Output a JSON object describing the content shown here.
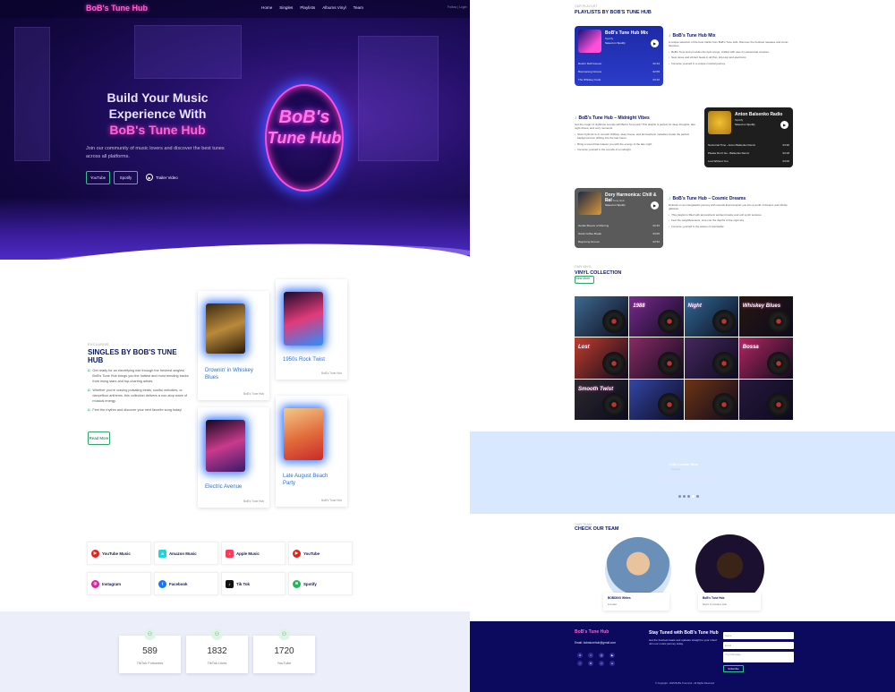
{
  "brand": "BoB's Tune Hub",
  "nav": [
    "Home",
    "Singles",
    "Playlists",
    "Albums Vinyl",
    "Team"
  ],
  "topbar_right": "Follow | Login",
  "hero": {
    "title_line1": "Build Your Music",
    "title_line2": "Experience With",
    "title_line3": "BoB's Tune Hub",
    "subtitle": "Join our community of music lovers and discover the best tunes across all platforms.",
    "btn_youtube": "YouTube",
    "btn_spotify": "Spotify",
    "trailer": "Trailer Video",
    "neon_line1": "BoB's",
    "neon_line2": "Tune Hub"
  },
  "singles": {
    "eyebrow": "EXCLUSIVE",
    "title": "SINGLES BY BOB'S TUNE HUB",
    "intro": "Get ready for an electrifying ride through the freshest singles! BoB's Tune Hub brings you the hottest and most trending tracks from rising stars and top-charting artists.",
    "bullet1": "Whether you're craving pulsating beats, soulful melodies, or dancefloor anthems, this collection delivers a non-stop wave of musical energy.",
    "bullet2": "Feel the rhythm and discover your next favorite song today!",
    "read_more": "Read More",
    "cards": [
      {
        "title": "Drownin' in Whiskey Blues",
        "foot": "BoB's Tune Hub"
      },
      {
        "title": "1950s Rock Twist",
        "foot": "BoB's Tune Hub"
      },
      {
        "title": "Electric Avenue",
        "foot": "BoB's Tune Hub"
      },
      {
        "title": "Late August Beach Party",
        "foot": "BoB's Tune Hub"
      }
    ]
  },
  "socials": [
    {
      "label": "YouTube Music",
      "color": "#e62117",
      "glyph": "▶"
    },
    {
      "label": "Amazon Music",
      "color": "#25d1da",
      "glyph": "a"
    },
    {
      "label": "Apple Music",
      "color": "#fa3c5a",
      "glyph": "♪"
    },
    {
      "label": "YouTube",
      "color": "#e62117",
      "glyph": "▶"
    },
    {
      "label": "Instagram",
      "color": "#d6249f",
      "glyph": "◎"
    },
    {
      "label": "Facebook",
      "color": "#1877f2",
      "glyph": "f"
    },
    {
      "label": "Tik Tok",
      "color": "#111111",
      "glyph": "♪"
    },
    {
      "label": "Spotify",
      "color": "#1db954",
      "glyph": "≋"
    }
  ],
  "stats": [
    {
      "num": "589",
      "label": "TikTok Followers"
    },
    {
      "num": "1832",
      "label": "TikTok Likes"
    },
    {
      "num": "1720",
      "label": "YouTube"
    }
  ],
  "playlists": {
    "eyebrow": "OUR PLAYLIST",
    "title": "PLAYLISTS BY BOB'S TUNE HUB",
    "items": [
      {
        "player_title": "BoB's Tune Hub Mix",
        "player_sub": "Spotify",
        "save": "Saved on Spotify",
        "tracks": [
          [
            "Rock'n Roll Forever",
            "02:34"
          ],
          [
            "Boomerang Groove",
            "02:55"
          ],
          [
            "The Whiskey Code",
            "03:10"
          ]
        ],
        "heading": "BoB's Tune Hub Mix",
        "desc": "A unique selection of the best tracks from BoB's Tune Hub. Discover the freshest releases and iconic favorites.",
        "b1": "BoB's Tune Hub provides the best songs, crafted with care by passionate creators.",
        "b2": "New tones and vibrant beats in all Pop, Hip-Hop and electronic.",
        "b3": "Immerse yourself in a unique musical journey."
      },
      {
        "player_title": "Anton Balsenko Radio",
        "player_sub": "Spotify",
        "save": "Saved on Spotify",
        "tracks": [
          [
            "Nocturnal Time - Anton Balsenko Remix",
            "03:30"
          ],
          [
            "Please Don't Go - Balsenko Remix",
            "03:18"
          ],
          [
            "Lost Without You",
            "03:00"
          ]
        ],
        "heading": "BoB's Tune Hub – Midnight Vibes",
        "desc": "Get the magic of nighttime sounds with Bob's Tune Hub! This playlist is perfect for deep thoughts, late night drives, and cozy moments.",
        "b1": "Slow rhythmic lo-fi, smooth chillhop, deep house, and atmospheric melodies create the perfect background for drifting into the late hours.",
        "b2": "Bring a sound that relaxes you with the energy of the late night.",
        "b3": "Immerse yourself in the sounds of a midnight."
      },
      {
        "player_title": "Dory Harmonica: Chill & Rel",
        "player_sub": "BoB's Tune Hub",
        "save": "Saved on Spotify",
        "tracks": [
          [
            "Gentle Breeze of Morning",
            "02:45"
          ],
          [
            "Sunlit Coffee Break",
            "03:05"
          ],
          [
            "Beginning Groove",
            "02:52"
          ]
        ],
        "heading": "BoB's Tune Hub – Cosmic Dreams",
        "desc": "Embark on an intergalactic journey with sounds that transport you into a world of dreams and infinite galaxies.",
        "b1": "This playlist is filled with atmospheric ambient tracks and soft synth textures.",
        "b2": "Feel the weightlessness, tune into the depths of the night sky.",
        "b3": "Immerse yourself in the waves of interstellar."
      }
    ]
  },
  "vinyl": {
    "eyebrow": "OUR VINYL",
    "title": "VINYL COLLECTION",
    "view_more": "View More →",
    "tiles": [
      {
        "label": "",
        "bg": "#3d6a8f"
      },
      {
        "label": "1988",
        "bg": "#7a2a8f"
      },
      {
        "label": "Night",
        "bg": "#2f6a94"
      },
      {
        "label": "Whiskey Blues",
        "bg": "#27170f"
      },
      {
        "label": "Lost",
        "bg": "#c13d2a"
      },
      {
        "label": "",
        "bg": "#8a2a64"
      },
      {
        "label": "",
        "bg": "#46285f"
      },
      {
        "label": "Bossa",
        "bg": "#b3275f"
      },
      {
        "label": "Smooth Twist",
        "bg": "#2c2a2d"
      },
      {
        "label": "",
        "bg": "#3346a6"
      },
      {
        "label": "",
        "bg": "#6e3412"
      },
      {
        "label": "",
        "bg": "#26183c"
      }
    ]
  },
  "testimonial": {
    "name": "Little Creator Nina",
    "role": "Listener",
    "quote": "BoB's Tune Hub is a total discovery for everyone who loves quality sound. Here, you can always find the perfect playlist for any mood — from energetic hits to relaxing atmospheric sounds."
  },
  "team": {
    "eyebrow": "OUR TEAM",
    "title": "CHECK OUR TEAM",
    "members": [
      {
        "name": "BOBDINO Writes",
        "role": "Founder"
      },
      {
        "name": "BoB's Tune Hub",
        "role": "Music & Creative Hub"
      }
    ]
  },
  "footer": {
    "brand": "BoB's Tune Hub",
    "email_label": "Email:",
    "email": "bobstunehub@gmail.com",
    "heading": "Stay Tuned with BoB's Tune Hub",
    "text": "Get the freshest beats and updates straight to your inbox! Join our music journey today.",
    "placeholder_name": "Name",
    "placeholder_email": "Email",
    "placeholder_message": "Your Message",
    "subscribe": "Subscribe",
    "copyright": "© Copyright - 2025 BoB's Tune Hub - All Rights Reserved"
  }
}
